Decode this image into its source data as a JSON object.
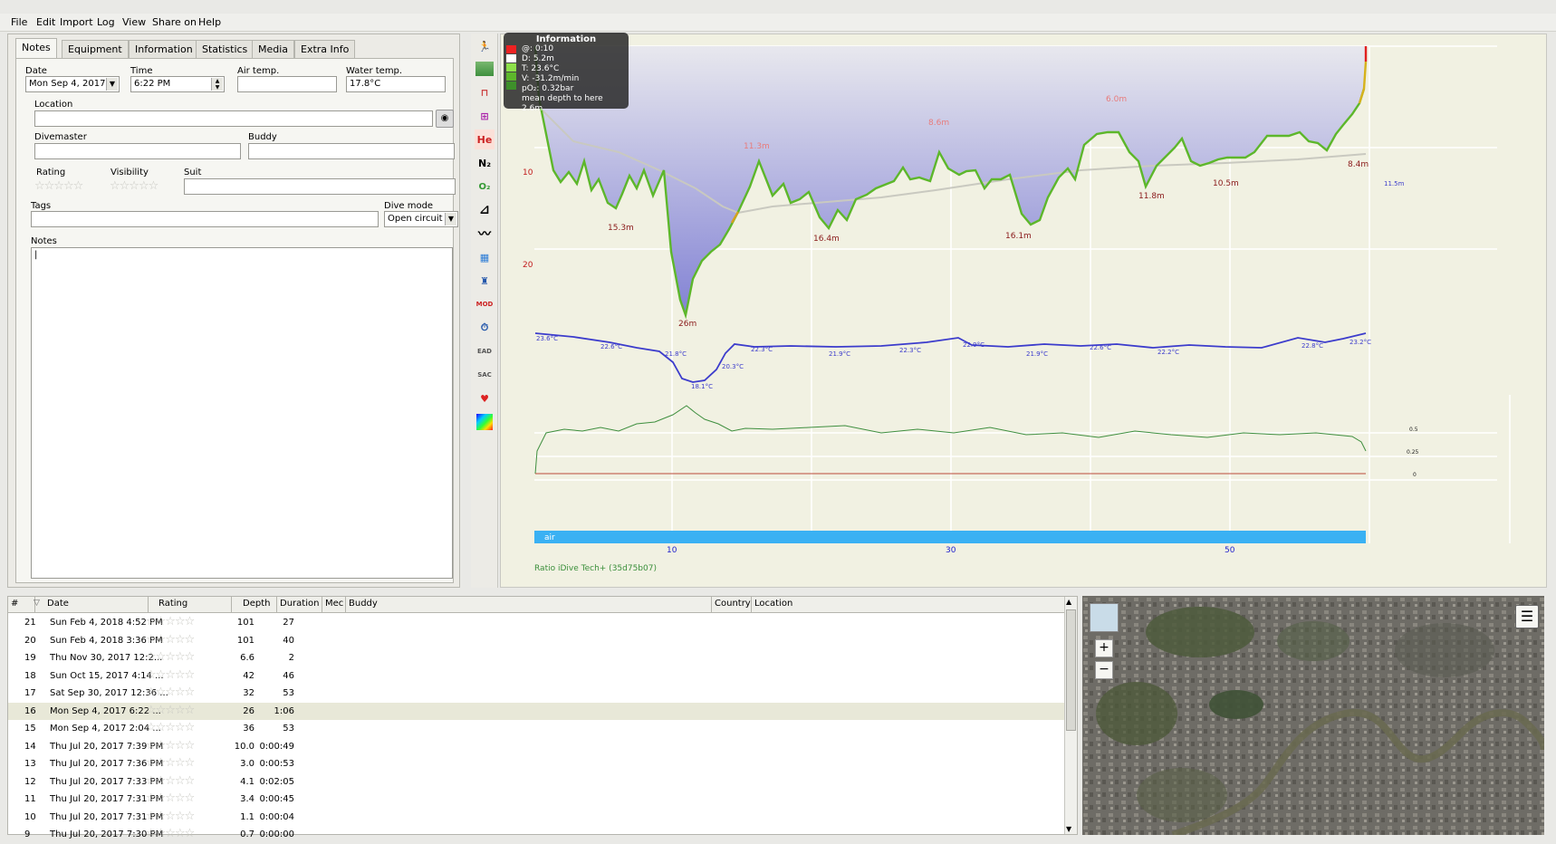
{
  "menu": [
    {
      "label": "File"
    },
    {
      "label": "Edit"
    },
    {
      "label": "Import"
    },
    {
      "label": "Log"
    },
    {
      "label": "View"
    },
    {
      "label": "Share on"
    },
    {
      "label": "Help"
    }
  ],
  "tabs": [
    "Notes",
    "Equipment",
    "Information",
    "Statistics",
    "Media",
    "Extra Info"
  ],
  "notes": {
    "date_label": "Date",
    "date_value": "Mon Sep 4, 2017",
    "time_label": "Time",
    "time_value": "6:22 PM",
    "air_temp_label": "Air temp.",
    "air_temp_value": "",
    "water_temp_label": "Water temp.",
    "water_temp_value": "17.8°C",
    "location_label": "Location",
    "location_value": "",
    "divemaster_label": "Divemaster",
    "divemaster_value": "",
    "buddy_label": "Buddy",
    "buddy_value": "",
    "rating_label": "Rating",
    "visibility_label": "Visibility",
    "suit_label": "Suit",
    "suit_value": "",
    "tags_label": "Tags",
    "tags_value": "",
    "dive_mode_label": "Dive mode",
    "dive_mode_value": "Open circuit",
    "notes_label": "Notes",
    "notes_value": "|"
  },
  "toolbar_icons": [
    "diver-icon",
    "ceiling-icon",
    "calc-ceiling-icon",
    "tissue-icon",
    "he-icon",
    "n2-icon",
    "o2-icon",
    "ppo2-scale-icon",
    "line-icon",
    "gas-icon",
    "mod-diver-icon",
    "mod-icon",
    "ndl-icon",
    "ead-icon",
    "sac-icon",
    "heartrate-icon",
    "heatmap-icon"
  ],
  "toolbar_text": {
    "he": "He",
    "n2": "N₂",
    "o2": "O₂",
    "mod": "MOD",
    "ead": "EAD",
    "sac": "SAC"
  },
  "info": {
    "title": "Information",
    "lines": [
      "@: 0:10",
      "D: 5.2m",
      "T: 23.6°C",
      "V: -31.2m/min",
      "pO₂: 0.32bar",
      "mean depth to here 2.6m"
    ]
  },
  "profile": {
    "depth_ticks": [
      "10",
      "20"
    ],
    "time_ticks": [
      "10",
      "30",
      "50"
    ],
    "depth_labels": [
      "15.3m",
      "26m",
      "11.3m",
      "16.4m",
      "8.6m",
      "16.1m",
      "6.0m",
      "11.8m",
      "10.5m",
      "8.4m",
      "11.5m"
    ],
    "temp_labels": [
      "23.6°C",
      "22.6°C",
      "21.8°C",
      "18.1°C",
      "20.3°C",
      "22.3°C",
      "21.9°C",
      "22.3°C",
      "22.9°C",
      "21.9°C",
      "22.6°C",
      "22.2°C",
      "22.8°C",
      "23.2°C"
    ],
    "po2_ticks": [
      "0.5",
      "0.25",
      "0"
    ],
    "gas_label": "air",
    "computer": "Ratio iDive Tech+ (35d75b07)"
  },
  "divelist": {
    "headers": [
      "#",
      "Date",
      "Rating",
      "Depth",
      "Duration",
      "Mec",
      "Buddy",
      "Country",
      "Location"
    ],
    "rows": [
      {
        "num": "21",
        "date": "Sun Feb 4, 2018 4:52 PM",
        "depth": "101",
        "duration": "27"
      },
      {
        "num": "20",
        "date": "Sun Feb 4, 2018 3:36 PM",
        "depth": "101",
        "duration": "40"
      },
      {
        "num": "19",
        "date": "Thu Nov 30, 2017 12:2...",
        "depth": "6.6",
        "duration": "2"
      },
      {
        "num": "18",
        "date": "Sun Oct 15, 2017 4:14 ...",
        "depth": "42",
        "duration": "46"
      },
      {
        "num": "17",
        "date": "Sat Sep 30, 2017 12:36 ...",
        "depth": "32",
        "duration": "53"
      },
      {
        "num": "16",
        "date": "Mon Sep 4, 2017 6:22 ...",
        "depth": "26",
        "duration": "1:06"
      },
      {
        "num": "15",
        "date": "Mon Sep 4, 2017 2:04 ...",
        "depth": "36",
        "duration": "53"
      },
      {
        "num": "14",
        "date": "Thu Jul 20, 2017 7:39 PM",
        "depth": "10.0",
        "duration": "0:00:49"
      },
      {
        "num": "13",
        "date": "Thu Jul 20, 2017 7:36 PM",
        "depth": "3.0",
        "duration": "0:00:53"
      },
      {
        "num": "12",
        "date": "Thu Jul 20, 2017 7:33 PM",
        "depth": "4.1",
        "duration": "0:02:05"
      },
      {
        "num": "11",
        "date": "Thu Jul 20, 2017 7:31 PM",
        "depth": "3.4",
        "duration": "0:00:45"
      },
      {
        "num": "10",
        "date": "Thu Jul 20, 2017 7:31 PM",
        "depth": "1.1",
        "duration": "0:00:04"
      },
      {
        "num": "9",
        "date": "Thu Jul 20, 2017 7:30 PM",
        "depth": "0.7",
        "duration": "0:00:00"
      }
    ],
    "selected_index": 5
  },
  "map": {
    "zoom_in": "+",
    "zoom_out": "−"
  },
  "colors": {
    "depth_fill": "#8f8fd8",
    "profile_line": "#5db72b",
    "temp_line": "#3c3ccc",
    "po2_line": "#3f8f3f",
    "gas_bar": "#3ab1f3",
    "depth_label": "#8a1a1a",
    "axis_blue": "#2222cc"
  }
}
